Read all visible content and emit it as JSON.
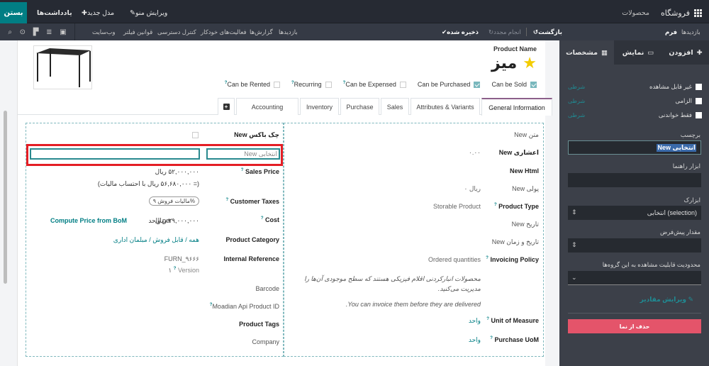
{
  "topbar": {
    "close_label": "بستن",
    "notes_label": "یادداشت‌ها",
    "new_model_label": "مدل جدید",
    "edit_menu_label": "ویرایش منو",
    "app_name": "فروشگاه",
    "menu_products": "محصولات"
  },
  "subbar": {
    "views_label": "بازدیدها",
    "form_label": "فرم",
    "undo_label": "بازگشت",
    "redo_label": "انجام مجدد",
    "saved_label": "ذخیره شده",
    "links": [
      "بازدیدها",
      "گزارش‌ها",
      "فعالیت‌های خودکار",
      "کنترل دسترسی",
      "قوانین فیلتر",
      "وب‌سایت"
    ],
    "view_icons": [
      "form-view-icon",
      "list-view-icon",
      "kanban-view-icon",
      "activity-view-icon",
      "search-view-icon"
    ]
  },
  "product": {
    "name_label": "Product Name",
    "name": "میز",
    "favorite": true,
    "flags": [
      {
        "label": "Can be Rented",
        "help": true,
        "checked": false
      },
      {
        "label": "Recurring",
        "help": true,
        "checked": false
      },
      {
        "label": "Can be Expensed",
        "help": true,
        "checked": false
      },
      {
        "label": "Can be Purchased",
        "help": false,
        "checked": true
      },
      {
        "label": "Can be Sold",
        "help": false,
        "checked": true
      }
    ]
  },
  "tabs": [
    {
      "label": "General Information",
      "active": true
    },
    {
      "label": "Attributes & Variants",
      "active": false
    },
    {
      "label": "Sales",
      "active": false
    },
    {
      "label": "Purchase",
      "active": false
    },
    {
      "label": "Inventory",
      "active": false
    },
    {
      "label": "Accounting",
      "active": false
    }
  ],
  "right_group": {
    "new_text": "New متن",
    "new_decimal_label": "New اعشاری",
    "new_decimal_value": "۰.۰۰",
    "new_html": "New Html",
    "new_monetary_label": "New پولی",
    "new_monetary_value": "۰ ریال",
    "product_type_label": "Product Type",
    "product_type_value": "Storable Product",
    "new_date": "New تاریخ",
    "new_datetime": "New تاریخ و زمان",
    "invoicing_policy_label": "Invoicing Policy",
    "invoicing_policy_value": "Ordered quantities",
    "storable_help": "محصولات انبارکردنی اقلام فیزیکی هستند که سطح موجودی آن‌ها را مدیریت می‌کنید.",
    "invoice_help": ".You can invoice them before they are delivered",
    "uom_label": "Unit of Measure",
    "uom_value": "واحد",
    "purchase_uom_label": "Purchase UoM",
    "purchase_uom_value": "واحد"
  },
  "left_group": {
    "new_checkbox_label": "New چک باکس",
    "new_selection_label": "New انتخابی",
    "sales_price_label": "Sales Price",
    "sales_price_value": "۵۲,۰۰۰,۰۰۰ ریال",
    "sales_price_tax": "(= ۵۶,۶۸۰,۰۰۰ ریال با احتساب مالیات)",
    "customer_taxes_label": "Customer Taxes",
    "customer_taxes_value": "مالیات فروش ۹%",
    "cost_label": "Cost",
    "cost_value": "۲۹,۰۰۰,۰۰۰ ریال",
    "cost_per": "per واحد",
    "compute_bom": "Compute Price from BoM",
    "category_label": "Product Category",
    "category_value": "همه / قابل فروش / مبلمان اداری",
    "internal_ref_label": "Internal Reference",
    "internal_ref_value": "FURN_۹۶۶۶",
    "version_label": "Version",
    "version_value": "۱",
    "barcode_label": "Barcode",
    "moadian_label": "Moadian Api Product ID",
    "tags_label": "Product Tags",
    "company_label": "Company"
  },
  "sidebar": {
    "tabs": [
      {
        "label": "مشخصات",
        "icon": "properties-icon",
        "active": true
      },
      {
        "label": "نمایش",
        "icon": "monitor-icon",
        "active": false
      },
      {
        "label": "افزودن",
        "icon": "plus-icon",
        "active": false
      }
    ],
    "checks": [
      {
        "label": "غیر قابل مشاهده",
        "cond": "شرطی"
      },
      {
        "label": "الزامی",
        "cond": "شرطی"
      },
      {
        "label": "فقط خواندنی",
        "cond": "شرطی"
      }
    ],
    "label_title": "برچسب",
    "label_value": "New انتخابی",
    "tooltip_title": "ابزار راهنما",
    "widget_title": "ابزارک",
    "widget_value": "انتخابی (selection)",
    "default_title": "مقدار پیش‌فرض",
    "groups_title": "محدودیت قابلیت مشاهده به این گروه‌ها",
    "edit_values": "ویرایش مقادیر",
    "remove_label": "حذف از نما"
  }
}
